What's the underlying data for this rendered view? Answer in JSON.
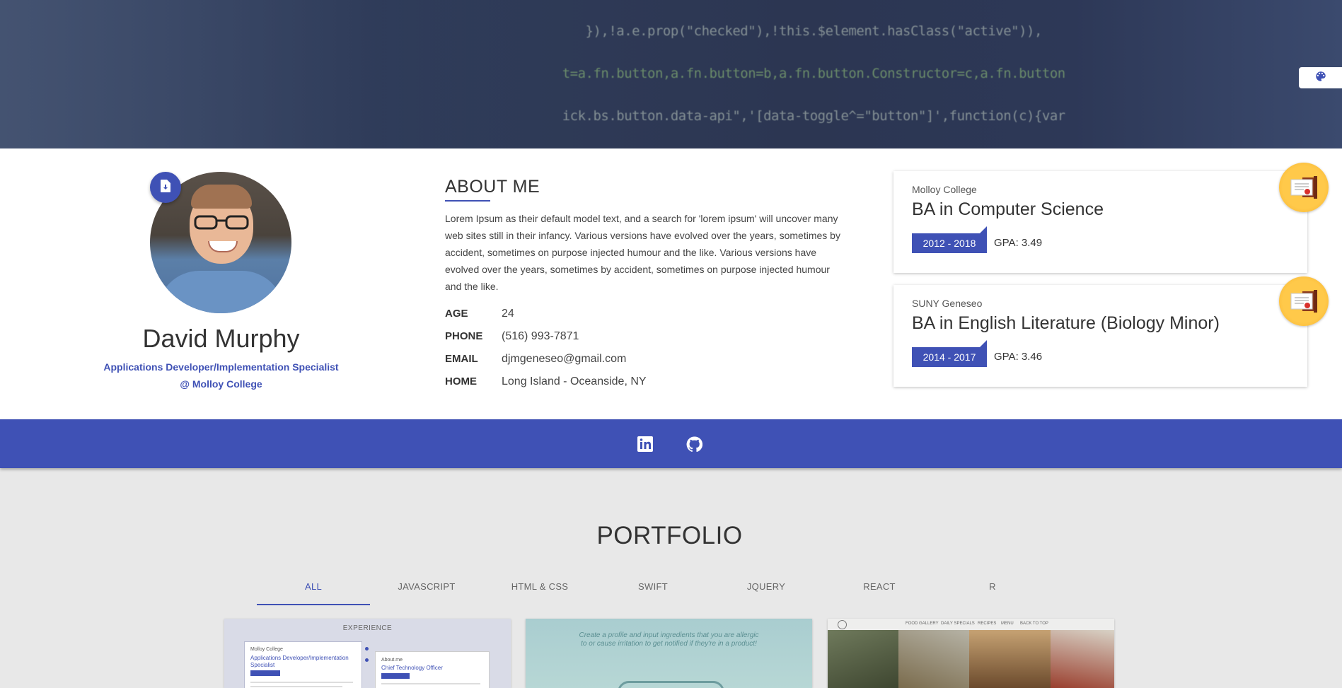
{
  "profile": {
    "name": "David Murphy",
    "role_line1": "Applications Developer/Implementation Specialist",
    "role_line2": "@ Molloy College"
  },
  "about": {
    "title": "ABOUT ME",
    "text": "Lorem Ipsum as their default model text, and a search for 'lorem ipsum' will uncover many web sites still in their infancy. Various versions have evolved over the years, sometimes by accident, sometimes on purpose injected humour and the like. Various versions have evolved over the years, sometimes by accident, sometimes on purpose injected humour and the like.",
    "info": [
      {
        "key": "AGE",
        "value": "24"
      },
      {
        "key": "PHONE",
        "value": "(516) 993-7871"
      },
      {
        "key": "EMAIL",
        "value": "djmgeneseo@gmail.com"
      },
      {
        "key": "HOME",
        "value": "Long Island - Oceanside, NY"
      }
    ]
  },
  "education": [
    {
      "school": "Molloy College",
      "degree": "BA in Computer Science",
      "years": "2012 - 2018",
      "gpa": "GPA: 3.49"
    },
    {
      "school": "SUNY Geneseo",
      "degree": "BA in English Literature (Biology Minor)",
      "years": "2014 - 2017",
      "gpa": "GPA: 3.46"
    }
  ],
  "social": [
    "linkedin-icon",
    "github-icon"
  ],
  "portfolio": {
    "title": "PORTFOLIO",
    "tabs": [
      "ALL",
      "JAVASCRIPT",
      "HTML & CSS",
      "SWIFT",
      "JQUERY",
      "REACT",
      "R"
    ],
    "active_tab": "ALL",
    "thumb1": {
      "label": "EXPERIENCE",
      "box1_school": "Molloy College",
      "box1_title": "Applications Developer/Implementation",
      "box1_title2": "Specialist",
      "box2_small": "About.me",
      "box2_title": "Chief Technology Officer"
    },
    "thumb2": {
      "text": "Create a profile and input ingredients that you are allergic to or cause irritation to get notified if they're in a product!"
    },
    "thumb3": {
      "nav": [
        "FOOD GALLERY",
        "DAILY SPECIALS",
        "RECIPES",
        "MENU",
        "BACK TO TOP"
      ]
    }
  },
  "colors": {
    "accent": "#3f51b5",
    "badge": "#ffc94a"
  },
  "icons": [
    "palette-icon",
    "file-download-icon",
    "diploma-icon",
    "linkedin-icon",
    "github-icon"
  ]
}
